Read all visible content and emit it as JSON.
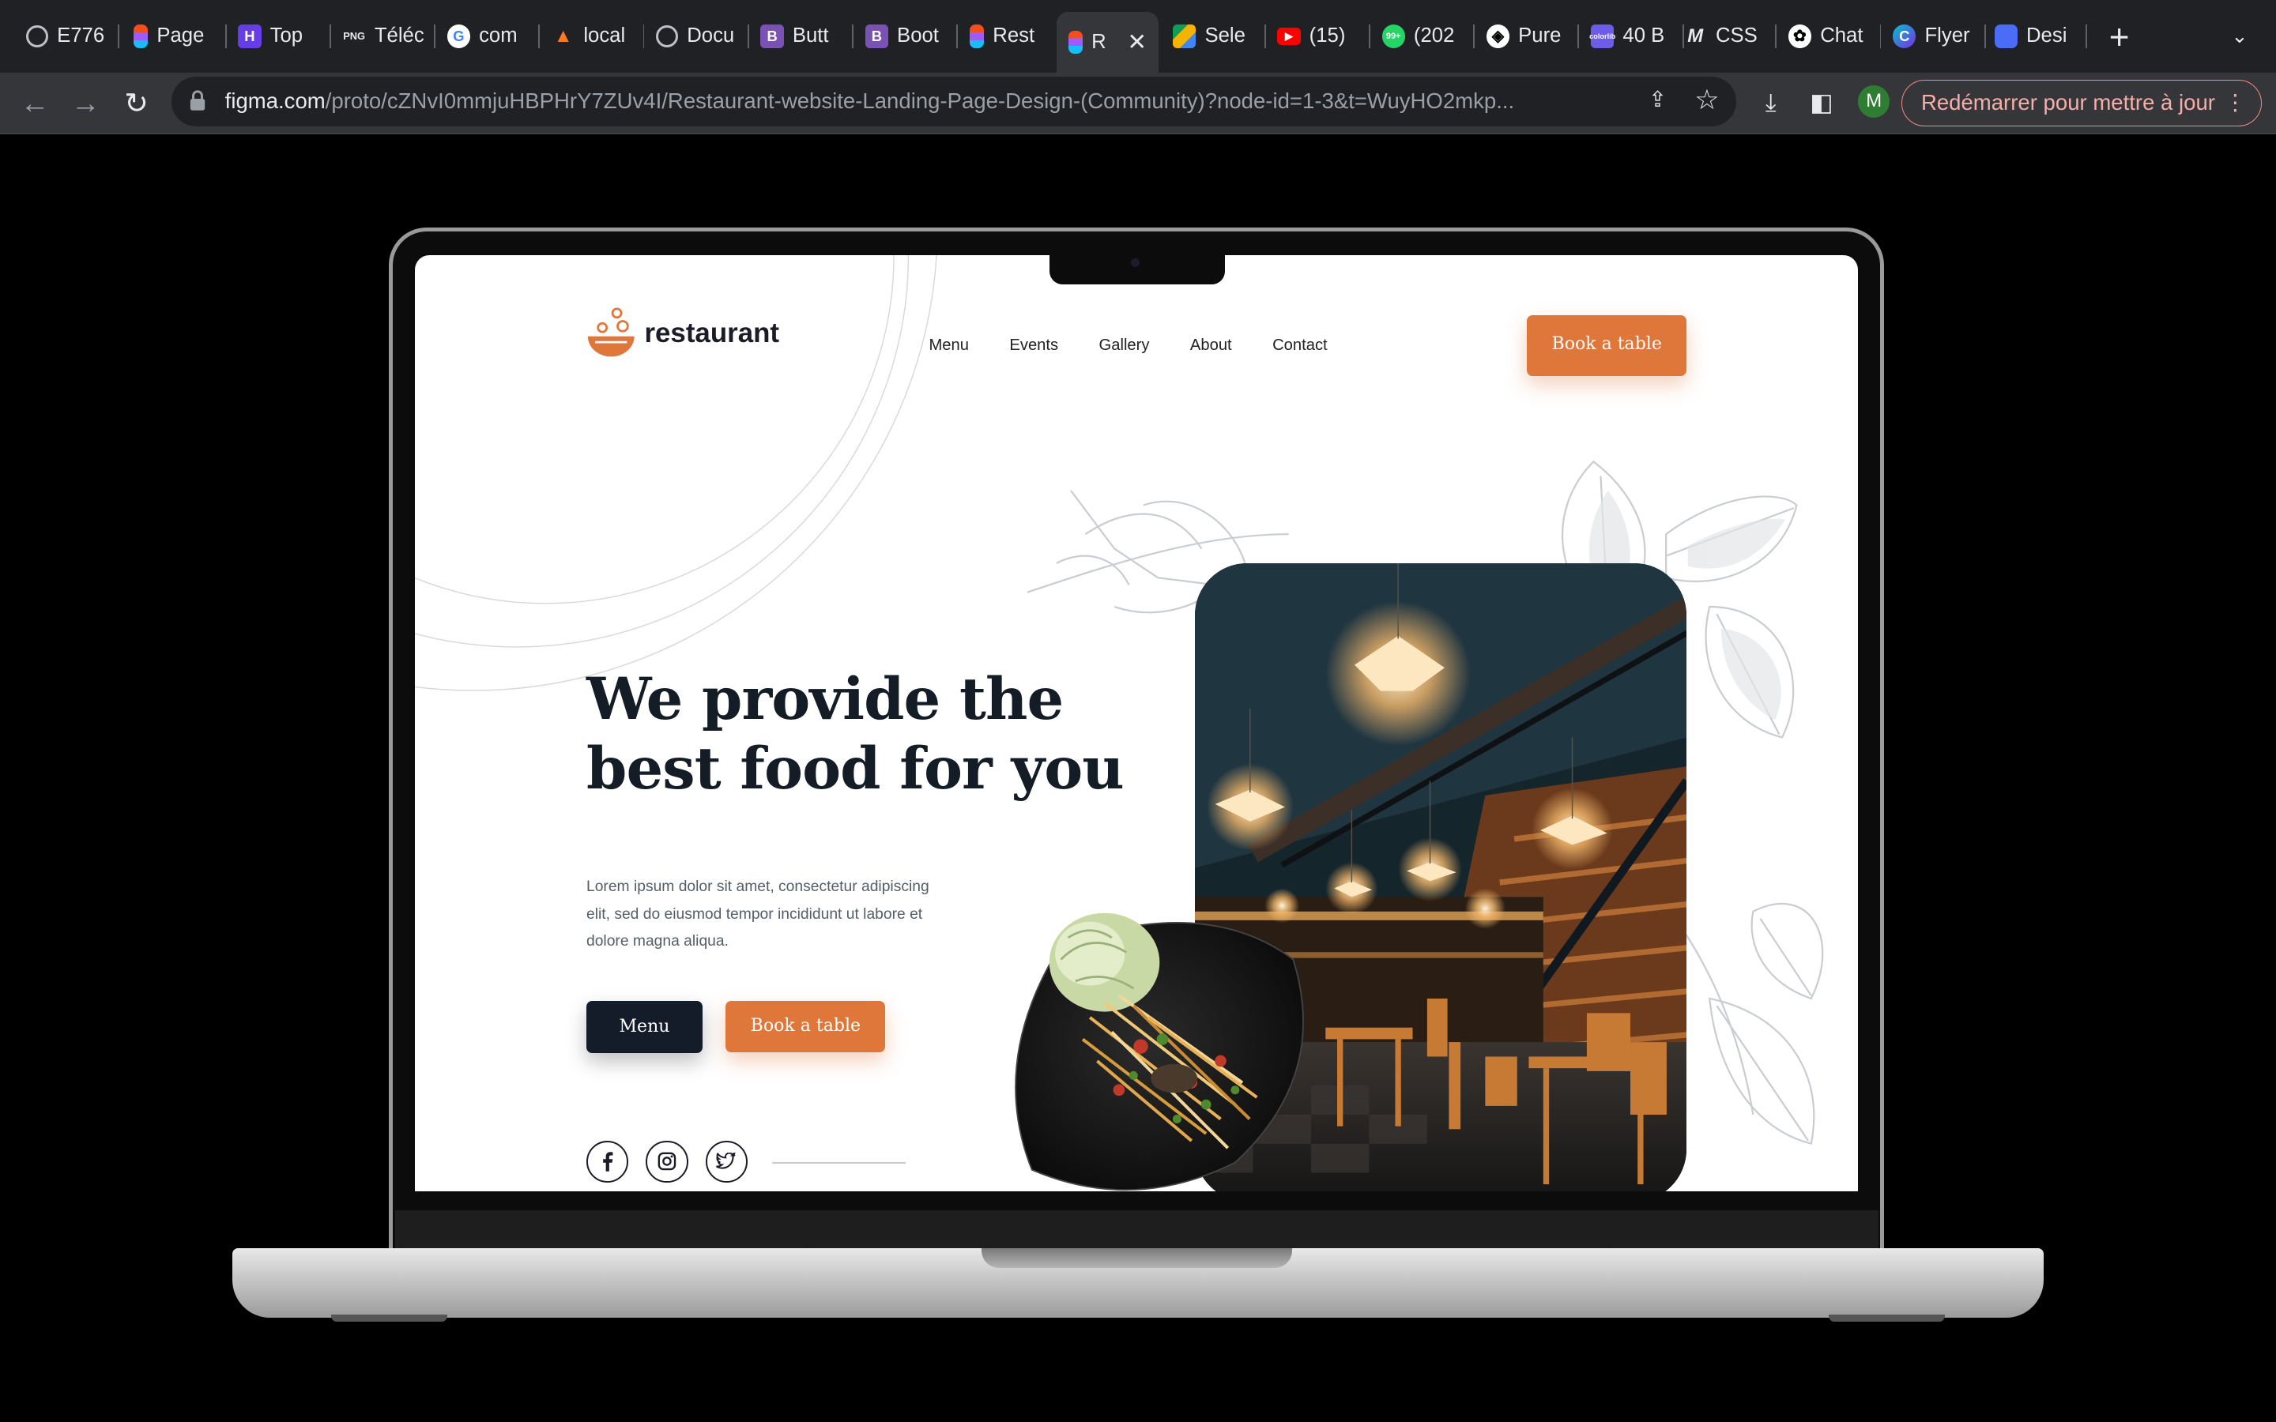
{
  "browser": {
    "tabs": [
      {
        "label": "E776",
        "icon": "globe-icon"
      },
      {
        "label": "Page",
        "icon": "figma-icon"
      },
      {
        "label": "Top",
        "icon": "hostinger-icon"
      },
      {
        "label": "Téléc",
        "icon": "png-icon"
      },
      {
        "label": "com",
        "icon": "google-icon"
      },
      {
        "label": "local",
        "icon": "xampp-icon"
      },
      {
        "label": "Docu",
        "icon": "globe-icon"
      },
      {
        "label": "Butt",
        "icon": "bootstrap-icon"
      },
      {
        "label": "Boot",
        "icon": "bootstrap-icon"
      },
      {
        "label": "Rest",
        "icon": "figma-icon"
      },
      {
        "label": "R",
        "icon": "figma-icon",
        "active": true
      },
      {
        "label": "Sele",
        "icon": "google-drive-icon"
      },
      {
        "label": "(15)",
        "icon": "youtube-icon"
      },
      {
        "label": "(202",
        "icon": "whatsapp-icon"
      },
      {
        "label": "Pure",
        "icon": "codepen-icon"
      },
      {
        "label": "40 B",
        "icon": "colorlib-icon"
      },
      {
        "label": "CSS",
        "icon": "medium-icon"
      },
      {
        "label": "Chat",
        "icon": "openai-icon"
      },
      {
        "label": "Flyer",
        "icon": "canva-icon"
      },
      {
        "label": "Desi",
        "icon": "design-icon"
      }
    ],
    "url_domain": "figma.com",
    "url_path": "/proto/cZNvI0mmjuHBPHrY7ZUv4I/Restaurant-website-Landing-Page-Design-(Community)?node-id=1-3&t=WuyHO2mkp...",
    "avatar_letter": "M",
    "restart_label": "Redémarrer pour mettre à jour",
    "new_tab": "+",
    "colors": {
      "tabbar": "#202124",
      "toolbar": "#35363a",
      "restart_border": "#f28b82"
    }
  },
  "site": {
    "logo_text": "restaurant",
    "nav": [
      "Menu",
      "Events",
      "Gallery",
      "About",
      "Contact"
    ],
    "nav_cta": "Book a table",
    "headline_line1": "We provide the",
    "headline_line2": "best food for you",
    "subtext": "Lorem ipsum dolor sit amet, consectetur adipiscing elit, sed do eiusmod tempor incididunt ut labore et dolore magna aliqua.",
    "btn_menu": "Menu",
    "btn_book": "Book a table",
    "social": [
      "facebook-icon",
      "instagram-icon",
      "twitter-icon"
    ],
    "colors": {
      "accent": "#e0773a",
      "dark": "#131c28",
      "text": "#555d66"
    }
  }
}
